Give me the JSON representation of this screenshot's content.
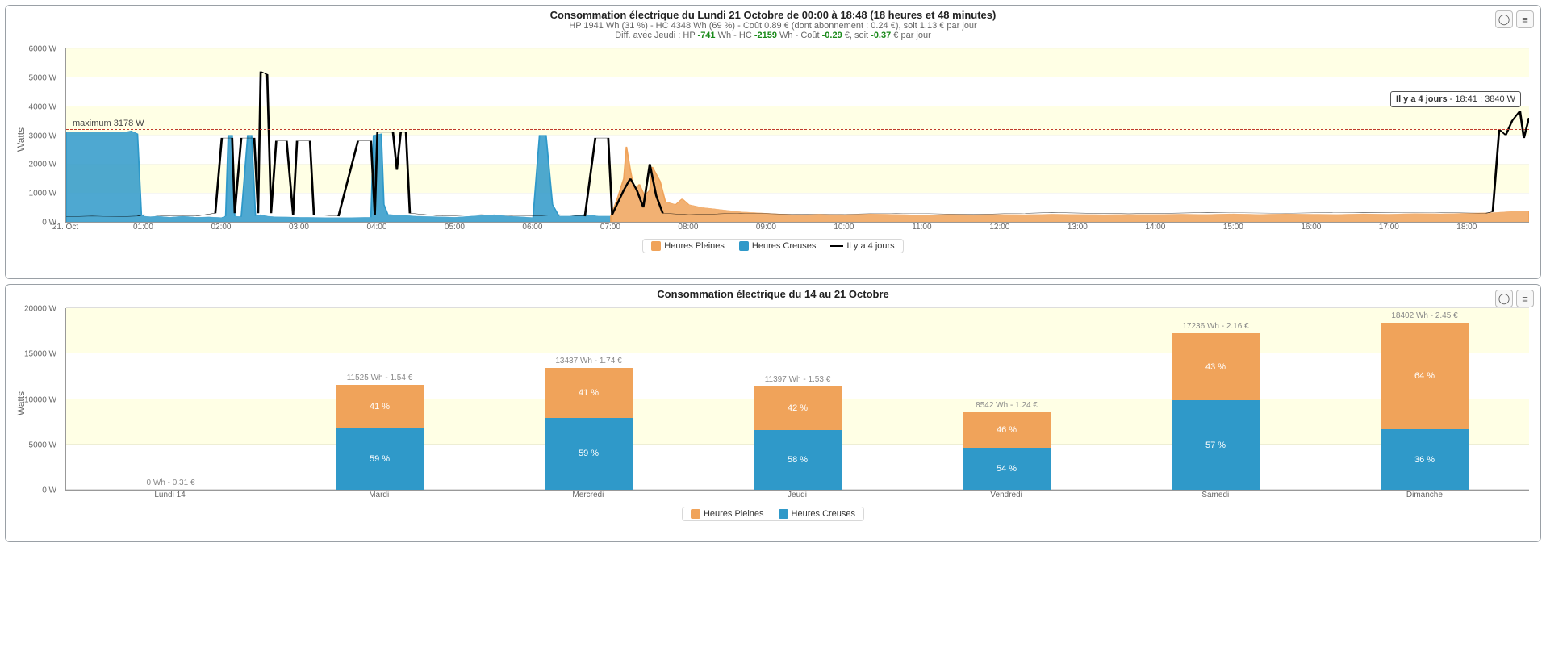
{
  "chart_data": [
    {
      "id": "top",
      "type": "line",
      "title": "Consommation électrique du Lundi 21 Octobre de 00:00 à 18:48 (18 heures et 48 minutes)",
      "subtitle1_parts": {
        "a": "HP 1941 Wh (31 %) - HC 4348 Wh (69 %) - Coût 0.89 € (dont abonnement : 0.24 €), soit 1.13 € par jour"
      },
      "subtitle2_parts": {
        "pre": "Diff. avec Jeudi : HP ",
        "hp": "-741",
        "mid": " Wh - HC ",
        "hc": "-2159",
        "mid2": " Wh - Coût ",
        "cost": "-0.29",
        "mid3": " €, soit ",
        "day": "-0.37",
        "post": " € par jour"
      },
      "ylabel": "Watts",
      "yticks": [
        "0 W",
        "1000 W",
        "2000 W",
        "3000 W",
        "4000 W",
        "5000 W",
        "6000 W"
      ],
      "ylim": [
        0,
        6000
      ],
      "xticks": [
        "21. Oct",
        "01:00",
        "02:00",
        "03:00",
        "04:00",
        "05:00",
        "06:00",
        "07:00",
        "08:00",
        "09:00",
        "10:00",
        "11:00",
        "12:00",
        "13:00",
        "14:00",
        "15:00",
        "16:00",
        "17:00",
        "18:00"
      ],
      "x_range_minutes": [
        0,
        1128
      ],
      "max_annotation": {
        "label": "maximum 3178 W",
        "value": 3178
      },
      "tooltip": {
        "series": "Il y a 4 jours",
        "text": "18:41 : 3840 W",
        "x_min": 1121,
        "y": 3840
      },
      "legend": [
        {
          "name": "Heures Pleines",
          "type": "sw",
          "color": "#f0a35a"
        },
        {
          "name": "Heures Creuses",
          "type": "sw",
          "color": "#2f99c9"
        },
        {
          "name": "Il y a 4 jours",
          "type": "ln",
          "color": "#000"
        }
      ],
      "series_area_hc": [
        [
          0,
          3100
        ],
        [
          5,
          3100
        ],
        [
          10,
          3100
        ],
        [
          20,
          3100
        ],
        [
          35,
          3100
        ],
        [
          45,
          3100
        ],
        [
          50,
          3150
        ],
        [
          55,
          3050
        ],
        [
          58,
          250
        ],
        [
          60,
          200
        ],
        [
          65,
          180
        ],
        [
          70,
          200
        ],
        [
          75,
          180
        ],
        [
          80,
          160
        ],
        [
          90,
          200
        ],
        [
          100,
          160
        ],
        [
          110,
          170
        ],
        [
          120,
          150
        ],
        [
          123,
          200
        ],
        [
          125,
          3000
        ],
        [
          128,
          3000
        ],
        [
          130,
          200
        ],
        [
          135,
          180
        ],
        [
          140,
          3000
        ],
        [
          143,
          3000
        ],
        [
          146,
          200
        ],
        [
          150,
          250
        ],
        [
          155,
          200
        ],
        [
          160,
          180
        ],
        [
          180,
          160
        ],
        [
          200,
          150
        ],
        [
          220,
          150
        ],
        [
          235,
          160
        ],
        [
          237,
          3000
        ],
        [
          243,
          3050
        ],
        [
          245,
          600
        ],
        [
          248,
          260
        ],
        [
          270,
          200
        ],
        [
          300,
          160
        ],
        [
          330,
          250
        ],
        [
          340,
          200
        ],
        [
          350,
          180
        ],
        [
          360,
          150
        ],
        [
          365,
          3000
        ],
        [
          370,
          3000
        ],
        [
          375,
          600
        ],
        [
          380,
          200
        ],
        [
          390,
          200
        ],
        [
          400,
          260
        ],
        [
          410,
          200
        ],
        [
          420,
          200
        ]
      ],
      "series_area_hp": [
        [
          420,
          200
        ],
        [
          425,
          800
        ],
        [
          430,
          1500
        ],
        [
          432,
          2600
        ],
        [
          435,
          1800
        ],
        [
          438,
          1100
        ],
        [
          442,
          1300
        ],
        [
          446,
          900
        ],
        [
          450,
          1100
        ],
        [
          452,
          1900
        ],
        [
          458,
          1400
        ],
        [
          462,
          700
        ],
        [
          470,
          600
        ],
        [
          475,
          800
        ],
        [
          480,
          600
        ],
        [
          490,
          500
        ],
        [
          500,
          450
        ],
        [
          520,
          350
        ],
        [
          540,
          300
        ],
        [
          560,
          250
        ],
        [
          580,
          270
        ],
        [
          600,
          250
        ],
        [
          620,
          280
        ],
        [
          640,
          260
        ],
        [
          660,
          240
        ],
        [
          680,
          260
        ],
        [
          700,
          250
        ],
        [
          720,
          260
        ],
        [
          740,
          250
        ],
        [
          760,
          270
        ],
        [
          780,
          260
        ],
        [
          800,
          250
        ],
        [
          820,
          260
        ],
        [
          840,
          260
        ],
        [
          860,
          270
        ],
        [
          880,
          260
        ],
        [
          900,
          280
        ],
        [
          920,
          260
        ],
        [
          940,
          280
        ],
        [
          960,
          270
        ],
        [
          980,
          260
        ],
        [
          1000,
          280
        ],
        [
          1020,
          270
        ],
        [
          1040,
          290
        ],
        [
          1060,
          280
        ],
        [
          1080,
          300
        ],
        [
          1100,
          320
        ],
        [
          1110,
          350
        ],
        [
          1120,
          380
        ],
        [
          1128,
          380
        ]
      ],
      "series_line_prev": [
        [
          0,
          180
        ],
        [
          20,
          200
        ],
        [
          40,
          180
        ],
        [
          55,
          200
        ],
        [
          60,
          250
        ],
        [
          80,
          200
        ],
        [
          100,
          200
        ],
        [
          115,
          300
        ],
        [
          120,
          2900
        ],
        [
          128,
          2900
        ],
        [
          130,
          300
        ],
        [
          135,
          2900
        ],
        [
          145,
          2900
        ],
        [
          148,
          300
        ],
        [
          150,
          5200
        ],
        [
          155,
          5100
        ],
        [
          158,
          300
        ],
        [
          162,
          2800
        ],
        [
          170,
          2800
        ],
        [
          175,
          250
        ],
        [
          178,
          2800
        ],
        [
          188,
          2800
        ],
        [
          191,
          250
        ],
        [
          210,
          200
        ],
        [
          225,
          2800
        ],
        [
          235,
          2800
        ],
        [
          238,
          250
        ],
        [
          240,
          3100
        ],
        [
          252,
          3100
        ],
        [
          255,
          1800
        ],
        [
          258,
          3100
        ],
        [
          262,
          3100
        ],
        [
          265,
          300
        ],
        [
          290,
          200
        ],
        [
          320,
          250
        ],
        [
          360,
          200
        ],
        [
          380,
          250
        ],
        [
          400,
          200
        ],
        [
          408,
          2900
        ],
        [
          418,
          2900
        ],
        [
          421,
          250
        ],
        [
          430,
          1100
        ],
        [
          435,
          1500
        ],
        [
          440,
          1100
        ],
        [
          445,
          500
        ],
        [
          450,
          2000
        ],
        [
          455,
          900
        ],
        [
          460,
          300
        ],
        [
          480,
          250
        ],
        [
          520,
          300
        ],
        [
          580,
          250
        ],
        [
          640,
          300
        ],
        [
          700,
          260
        ],
        [
          760,
          320
        ],
        [
          820,
          280
        ],
        [
          880,
          320
        ],
        [
          940,
          300
        ],
        [
          1000,
          330
        ],
        [
          1060,
          320
        ],
        [
          1095,
          300
        ],
        [
          1100,
          350
        ],
        [
          1105,
          3200
        ],
        [
          1110,
          3000
        ],
        [
          1115,
          3500
        ],
        [
          1121,
          3840
        ],
        [
          1124,
          2900
        ],
        [
          1128,
          3600
        ]
      ]
    },
    {
      "id": "bottom",
      "type": "bar",
      "title": "Consommation électrique du 14 au 21 Octobre",
      "ylabel": "Watts",
      "yticks": [
        "0 W",
        "5000 W",
        "10000 W",
        "15000 W",
        "20000 W"
      ],
      "ylim": [
        0,
        20000
      ],
      "legend": [
        {
          "name": "Heures Pleines",
          "type": "sw",
          "color": "#f0a35a"
        },
        {
          "name": "Heures Creuses",
          "type": "sw",
          "color": "#2f99c9"
        }
      ],
      "categories": [
        "Lundi 14",
        "Mardi",
        "Mercredi",
        "Jeudi",
        "Vendredi",
        "Samedi",
        "Dimanche"
      ],
      "bars": [
        {
          "cat": "Lundi 14",
          "top_label": "0 Wh - 0.31 €",
          "hp": 0,
          "hc": 0,
          "hp_pct": "",
          "hc_pct": ""
        },
        {
          "cat": "Mardi",
          "top_label": "11525 Wh - 1.54 €",
          "hp": 4725,
          "hc": 6800,
          "hp_pct": "41 %",
          "hc_pct": "59 %"
        },
        {
          "cat": "Mercredi",
          "top_label": "13437 Wh - 1.74 €",
          "hp": 5509,
          "hc": 7928,
          "hp_pct": "41 %",
          "hc_pct": "59 %"
        },
        {
          "cat": "Jeudi",
          "top_label": "11397 Wh - 1.53 €",
          "hp": 4787,
          "hc": 6610,
          "hp_pct": "42 %",
          "hc_pct": "58 %"
        },
        {
          "cat": "Vendredi",
          "top_label": "8542 Wh - 1.24 €",
          "hp": 3929,
          "hc": 4613,
          "hp_pct": "46 %",
          "hc_pct": "54 %"
        },
        {
          "cat": "Samedi",
          "top_label": "17236 Wh - 2.16 €",
          "hp": 7411,
          "hc": 9825,
          "hp_pct": "43 %",
          "hc_pct": "57 %"
        },
        {
          "cat": "Dimanche",
          "top_label": "18402 Wh - 2.45 €",
          "hp": 11777,
          "hc": 6625,
          "hp_pct": "64 %",
          "hc_pct": "36 %"
        }
      ]
    }
  ]
}
